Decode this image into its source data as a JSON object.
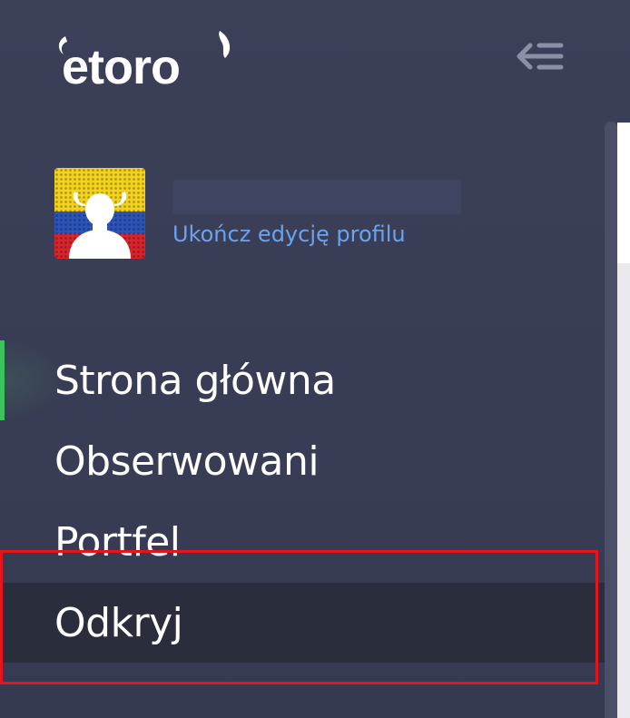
{
  "app": {
    "logo_text": "etoro"
  },
  "header": {
    "collapse_icon": "collapse-menu-icon"
  },
  "profile": {
    "avatar_icon": "user-avatar-icon",
    "complete_profile_link": "Ukończ edycję profilu"
  },
  "nav": {
    "items": [
      {
        "label": "Strona główna",
        "active": true
      },
      {
        "label": "Obserwowani",
        "active": false
      },
      {
        "label": "Portfel",
        "active": false
      },
      {
        "label": "Odkryj",
        "active": false,
        "hovered": true
      }
    ]
  },
  "colors": {
    "sidebar_bg": "#3a3f57",
    "active_indicator": "#3cc35e",
    "link": "#6aa3f0",
    "hover_bg": "#2a2d3c",
    "annotation_box": "#e8141b"
  }
}
